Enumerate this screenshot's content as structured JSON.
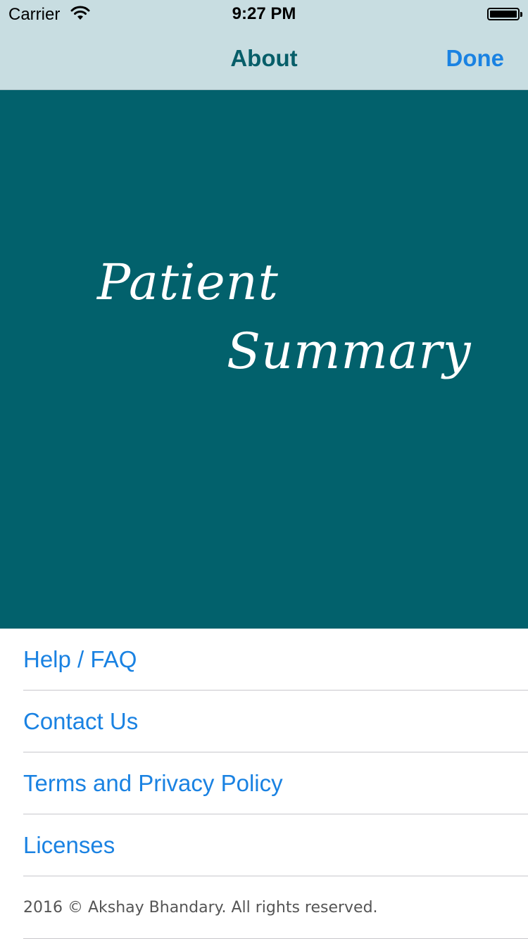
{
  "status_bar": {
    "carrier": "Carrier",
    "time": "9:27 PM",
    "wifi_icon": "wifi-icon",
    "battery_icon": "battery-icon"
  },
  "nav": {
    "title": "About",
    "done_label": "Done"
  },
  "hero": {
    "logo_line1": "Patient",
    "logo_line2": "Summary",
    "background_color": "#02616c"
  },
  "menu": {
    "items": [
      {
        "label": "Help / FAQ"
      },
      {
        "label": "Contact Us"
      },
      {
        "label": "Terms and Privacy Policy"
      },
      {
        "label": "Licenses"
      }
    ]
  },
  "footer": {
    "copyright": "2016 ©  Akshay Bhandary. All rights reserved."
  },
  "colors": {
    "accent": "#1a82e2",
    "nav_background": "#c8dde1",
    "nav_title": "#075e69"
  }
}
